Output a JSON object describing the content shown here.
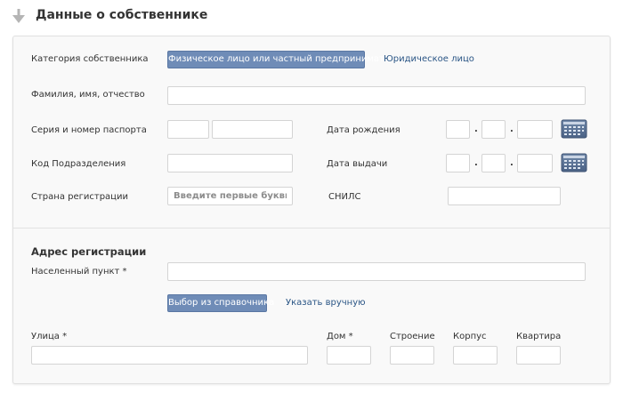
{
  "header": {
    "title": "Данные о собственнике"
  },
  "owner": {
    "category_label": "Категория собственника",
    "category_selected": "Физическое лицо или частный предприниматель",
    "category_other": "Юридическое лицо",
    "fullname_label": "Фамилия, имя, отчество",
    "fullname_value": "",
    "passport_label": "Серия и номер паспорта",
    "passport_series": "",
    "passport_number": "",
    "birth_label": "Дата рождения",
    "birth_separator": ".",
    "dept_code_label": "Код Подразделения",
    "dept_code_value": "",
    "issue_label": "Дата выдачи",
    "country_label": "Страна регистрации",
    "country_placeholder": "Введите первые буквы",
    "snils_label": "СНИЛС",
    "snils_value": ""
  },
  "address": {
    "section_title": "Адрес регистрации",
    "locality_label": "Населенный пункт *",
    "locality_value": "",
    "directory_button": "Выбор из справочника",
    "manual_link": "Указать вручную",
    "street_label": "Улица *",
    "house_label": "Дом *",
    "building_label": "Строение",
    "block_label": "Корпус",
    "apartment_label": "Квартира"
  },
  "colors": {
    "accent_button": "#6f8cb7",
    "link": "#2a5585",
    "calendar_icon": "#5b7191"
  },
  "icons": {
    "header": "arrow-down-icon",
    "date_picker": "calendar-icon"
  }
}
